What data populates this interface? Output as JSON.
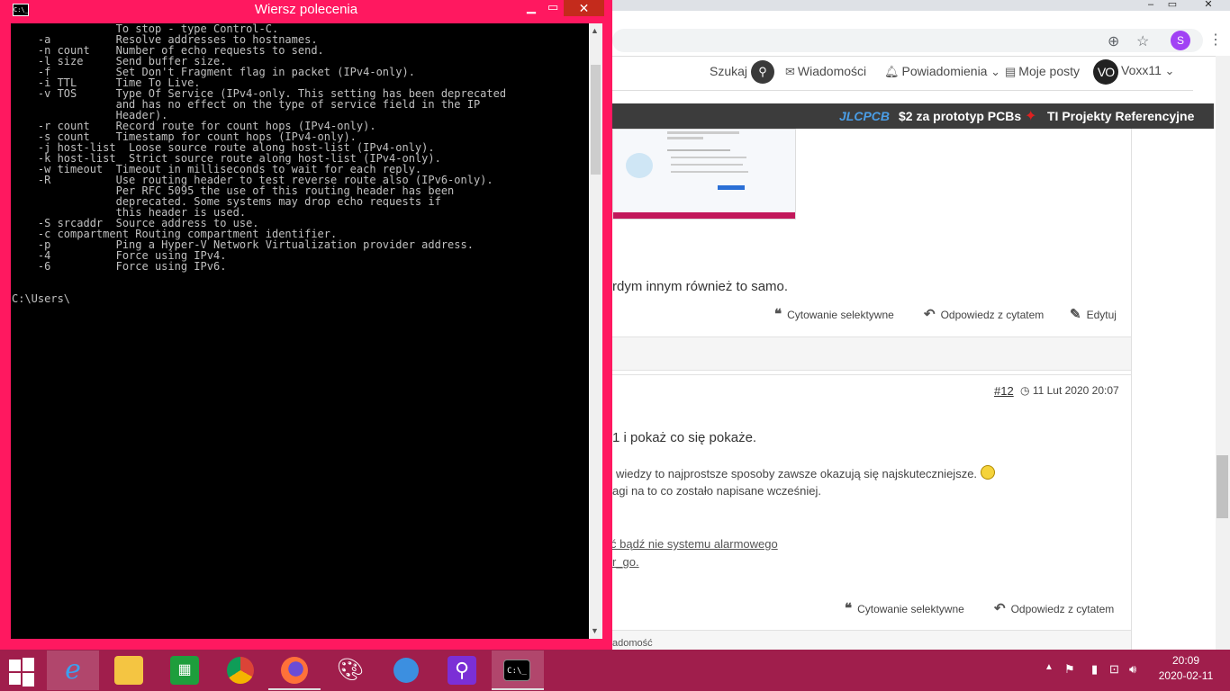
{
  "cmd": {
    "title": "Wiersz polecenia",
    "icon_text": "C:\\_",
    "lines": [
      "                To stop - type Control-C.",
      "    -a          Resolve addresses to hostnames.",
      "    -n count    Number of echo requests to send.",
      "    -l size     Send buffer size.",
      "    -f          Set Don't Fragment flag in packet (IPv4-only).",
      "    -i TTL      Time To Live.",
      "    -v TOS      Type Of Service (IPv4-only. This setting has been deprecated",
      "                and has no effect on the type of service field in the IP",
      "                Header).",
      "    -r count    Record route for count hops (IPv4-only).",
      "    -s count    Timestamp for count hops (IPv4-only).",
      "    -j host-list  Loose source route along host-list (IPv4-only).",
      "    -k host-list  Strict source route along host-list (IPv4-only).",
      "    -w timeout  Timeout in milliseconds to wait for each reply.",
      "    -R          Use routing header to test reverse route also (IPv6-only).",
      "                Per RFC 5095 the use of this routing header has been",
      "                deprecated. Some systems may drop echo requests if",
      "                this header is used.",
      "    -S srcaddr  Source address to use.",
      "    -c compartment Routing compartment identifier.",
      "    -p          Ping a Hyper-V Network Virtualization provider address.",
      "    -4          Force using IPv4.",
      "    -6          Force using IPv6.",
      "",
      "",
      "C:\\Users\\"
    ]
  },
  "browser": {
    "nav": {
      "search": "Szukaj",
      "messages": "Wiadomości",
      "notifications": "Powiadomienia",
      "my_posts": "Moje posty",
      "username": "Voxx11",
      "avatar_initials": "VO",
      "profile_initial": "S"
    },
    "ad": {
      "jlc_brand": "JLCPCB",
      "jlc_text": "$2 za prototyp PCBs",
      "ti_text": "TI Projekty Referencyjne"
    },
    "post1": {
      "text": "rdym innym również to samo.",
      "quote_selective": "Cytowanie selektywne",
      "reply_quote": "Odpowiedz z cytatem",
      "edit": "Edytuj"
    },
    "post2": {
      "number": "#12",
      "date": "11 Lut 2020 20:07",
      "line1": "1 i pokaż co się pokaże.",
      "line2": "wiedzy to najprostsze sposoby zawsze okazują się najskuteczniejsze.",
      "line3": "agi na to co zostało napisane wcześniej.",
      "link1": "ć bądź nie systemu alarmowego",
      "link2": "r_go.",
      "quote_selective": "Cytowanie selektywne",
      "reply_quote": "Odpowiedz z cytatem"
    },
    "footer_hint": "adomość"
  },
  "taskbar": {
    "time": "20:09",
    "date": "2020-02-11"
  }
}
